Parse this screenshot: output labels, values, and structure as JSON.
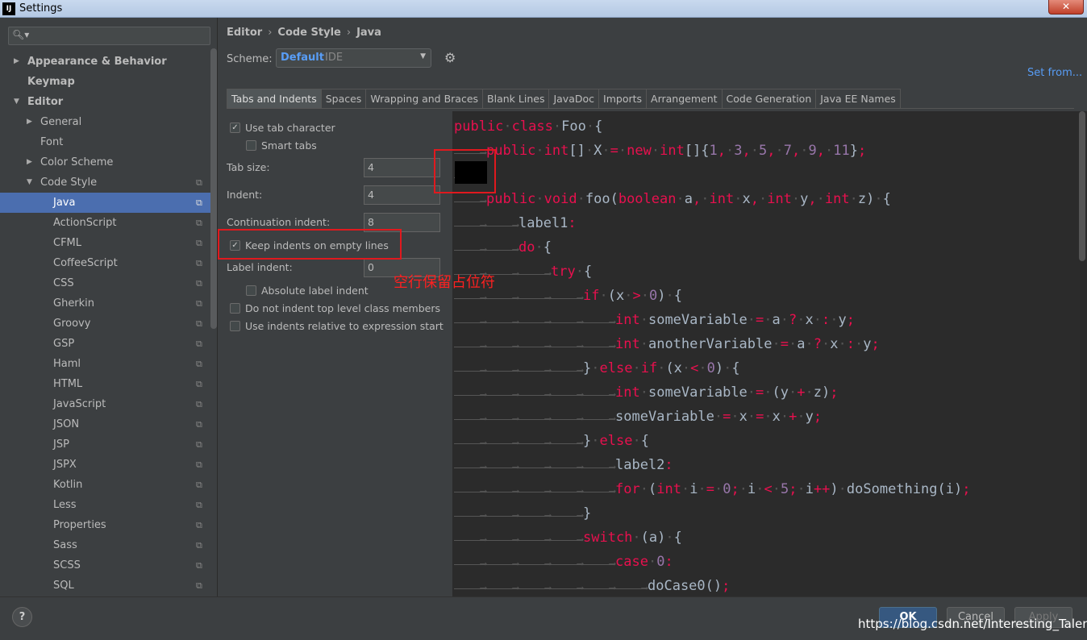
{
  "window": {
    "app_icon": "IJ",
    "title": "Settings",
    "close": "✕"
  },
  "sidebar": {
    "search_placeholder": "",
    "items": [
      {
        "label": "Appearance & Behavior",
        "bold": true,
        "arrow": "▶",
        "level": 0
      },
      {
        "label": "Keymap",
        "bold": true,
        "arrow": "",
        "level": 0
      },
      {
        "label": "Editor",
        "bold": true,
        "arrow": "▼",
        "level": 0
      },
      {
        "label": "General",
        "arrow": "▶",
        "level": 1
      },
      {
        "label": "Font",
        "arrow": "",
        "level": 1
      },
      {
        "label": "Color Scheme",
        "arrow": "▶",
        "level": 1
      },
      {
        "label": "Code Style",
        "arrow": "▼",
        "level": 1,
        "copy": true
      },
      {
        "label": "Java",
        "level": 2,
        "copy": true,
        "selected": true
      },
      {
        "label": "ActionScript",
        "level": 2,
        "copy": true
      },
      {
        "label": "CFML",
        "level": 2,
        "copy": true
      },
      {
        "label": "CoffeeScript",
        "level": 2,
        "copy": true
      },
      {
        "label": "CSS",
        "level": 2,
        "copy": true
      },
      {
        "label": "Gherkin",
        "level": 2,
        "copy": true
      },
      {
        "label": "Groovy",
        "level": 2,
        "copy": true
      },
      {
        "label": "GSP",
        "level": 2,
        "copy": true
      },
      {
        "label": "Haml",
        "level": 2,
        "copy": true
      },
      {
        "label": "HTML",
        "level": 2,
        "copy": true
      },
      {
        "label": "JavaScript",
        "level": 2,
        "copy": true
      },
      {
        "label": "JSON",
        "level": 2,
        "copy": true
      },
      {
        "label": "JSP",
        "level": 2,
        "copy": true
      },
      {
        "label": "JSPX",
        "level": 2,
        "copy": true
      },
      {
        "label": "Kotlin",
        "level": 2,
        "copy": true
      },
      {
        "label": "Less",
        "level": 2,
        "copy": true
      },
      {
        "label": "Properties",
        "level": 2,
        "copy": true
      },
      {
        "label": "Sass",
        "level": 2,
        "copy": true
      },
      {
        "label": "SCSS",
        "level": 2,
        "copy": true
      },
      {
        "label": "SQL",
        "level": 2,
        "copy": true
      }
    ]
  },
  "breadcrumb": {
    "p1": "Editor",
    "p2": "Code Style",
    "p3": "Java",
    "sep": "›"
  },
  "scheme": {
    "label": "Scheme:",
    "value": "Default",
    "suffix": "IDE",
    "set_from": "Set from..."
  },
  "tabs": [
    "Tabs and Indents",
    "Spaces",
    "Wrapping and Braces",
    "Blank Lines",
    "JavaDoc",
    "Imports",
    "Arrangement",
    "Code Generation",
    "Java EE Names"
  ],
  "options": {
    "use_tab_character": "Use tab character",
    "smart_tabs": "Smart tabs",
    "tab_size_label": "Tab size:",
    "tab_size": "4",
    "indent_label": "Indent:",
    "indent": "4",
    "continuation_label": "Continuation indent:",
    "continuation": "8",
    "keep_indents": "Keep indents on empty lines",
    "label_indent_label": "Label indent:",
    "label_indent": "0",
    "absolute_label": "Absolute label indent",
    "no_indent_top": "Do not indent top level class members",
    "relative_indents": "Use indents relative to expression start"
  },
  "annotation": "空行保留占位符",
  "code_lines": [
    {
      "indent": 0,
      "tokens": [
        [
          "kw",
          "public"
        ],
        [
          "dot",
          "·"
        ],
        [
          "kw",
          "class"
        ],
        [
          "dot",
          "·"
        ],
        [
          "t",
          "Foo"
        ],
        [
          "dot",
          "·"
        ],
        [
          "t",
          "{"
        ]
      ]
    },
    {
      "indent": 1,
      "tokens": [
        [
          "kw",
          "public"
        ],
        [
          "dot",
          "·"
        ],
        [
          "kw",
          "int"
        ],
        [
          "t",
          "[]"
        ],
        [
          "dot",
          "·"
        ],
        [
          "t",
          "X"
        ],
        [
          "dot",
          "·"
        ],
        [
          "kw",
          "="
        ],
        [
          "dot",
          "·"
        ],
        [
          "kw",
          "new"
        ],
        [
          "dot",
          "·"
        ],
        [
          "kw",
          "int"
        ],
        [
          "t",
          "[]{"
        ],
        [
          "n",
          "1"
        ],
        [
          "kw",
          ","
        ],
        [
          "dot",
          "·"
        ],
        [
          "n",
          "3"
        ],
        [
          "kw",
          ","
        ],
        [
          "dot",
          "·"
        ],
        [
          "n",
          "5"
        ],
        [
          "kw",
          ","
        ],
        [
          "dot",
          "·"
        ],
        [
          "n",
          "7"
        ],
        [
          "kw",
          ","
        ],
        [
          "dot",
          "·"
        ],
        [
          "n",
          "9"
        ],
        [
          "kw",
          ","
        ],
        [
          "dot",
          "·"
        ],
        [
          "n",
          "11"
        ],
        [
          "t",
          "}"
        ],
        [
          "kw",
          ";"
        ]
      ]
    },
    {
      "indent": 1,
      "tokens": []
    },
    {
      "indent": 1,
      "tokens": [
        [
          "kw",
          "public"
        ],
        [
          "dot",
          "·"
        ],
        [
          "kw",
          "void"
        ],
        [
          "dot",
          "·"
        ],
        [
          "t",
          "foo("
        ],
        [
          "kw",
          "boolean"
        ],
        [
          "dot",
          "·"
        ],
        [
          "t",
          "a"
        ],
        [
          "kw",
          ","
        ],
        [
          "dot",
          "·"
        ],
        [
          "kw",
          "int"
        ],
        [
          "dot",
          "·"
        ],
        [
          "t",
          "x"
        ],
        [
          "kw",
          ","
        ],
        [
          "dot",
          "·"
        ],
        [
          "kw",
          "int"
        ],
        [
          "dot",
          "·"
        ],
        [
          "t",
          "y"
        ],
        [
          "kw",
          ","
        ],
        [
          "dot",
          "·"
        ],
        [
          "kw",
          "int"
        ],
        [
          "dot",
          "·"
        ],
        [
          "t",
          "z)"
        ],
        [
          "dot",
          "·"
        ],
        [
          "t",
          "{"
        ]
      ]
    },
    {
      "indent": 2,
      "tokens": [
        [
          "t",
          "label1"
        ],
        [
          "kw",
          ":"
        ]
      ]
    },
    {
      "indent": 2,
      "tokens": [
        [
          "kw",
          "do"
        ],
        [
          "dot",
          "·"
        ],
        [
          "t",
          "{"
        ]
      ]
    },
    {
      "indent": 3,
      "tokens": [
        [
          "kw",
          "try"
        ],
        [
          "dot",
          "·"
        ],
        [
          "t",
          "{"
        ]
      ]
    },
    {
      "indent": 4,
      "tokens": [
        [
          "kw",
          "if"
        ],
        [
          "dot",
          "·"
        ],
        [
          "t",
          "(x"
        ],
        [
          "dot",
          "·"
        ],
        [
          "kw",
          ">"
        ],
        [
          "dot",
          "·"
        ],
        [
          "n",
          "0"
        ],
        [
          "t",
          ")"
        ],
        [
          "dot",
          "·"
        ],
        [
          "t",
          "{"
        ]
      ]
    },
    {
      "indent": 5,
      "tokens": [
        [
          "kw",
          "int"
        ],
        [
          "dot",
          "·"
        ],
        [
          "t",
          "someVariable"
        ],
        [
          "dot",
          "·"
        ],
        [
          "kw",
          "="
        ],
        [
          "dot",
          "·"
        ],
        [
          "t",
          "a"
        ],
        [
          "dot",
          "·"
        ],
        [
          "kw",
          "?"
        ],
        [
          "dot",
          "·"
        ],
        [
          "t",
          "x"
        ],
        [
          "dot",
          "·"
        ],
        [
          "kw",
          ":"
        ],
        [
          "dot",
          "·"
        ],
        [
          "t",
          "y"
        ],
        [
          "kw",
          ";"
        ]
      ]
    },
    {
      "indent": 5,
      "tokens": [
        [
          "kw",
          "int"
        ],
        [
          "dot",
          "·"
        ],
        [
          "t",
          "anotherVariable"
        ],
        [
          "dot",
          "·"
        ],
        [
          "kw",
          "="
        ],
        [
          "dot",
          "·"
        ],
        [
          "t",
          "a"
        ],
        [
          "dot",
          "·"
        ],
        [
          "kw",
          "?"
        ],
        [
          "dot",
          "·"
        ],
        [
          "t",
          "x"
        ],
        [
          "dot",
          "·"
        ],
        [
          "kw",
          ":"
        ],
        [
          "dot",
          "·"
        ],
        [
          "t",
          "y"
        ],
        [
          "kw",
          ";"
        ]
      ]
    },
    {
      "indent": 4,
      "tokens": [
        [
          "t",
          "}"
        ],
        [
          "dot",
          "·"
        ],
        [
          "kw",
          "else"
        ],
        [
          "dot",
          "·"
        ],
        [
          "kw",
          "if"
        ],
        [
          "dot",
          "·"
        ],
        [
          "t",
          "(x"
        ],
        [
          "dot",
          "·"
        ],
        [
          "kw",
          "<"
        ],
        [
          "dot",
          "·"
        ],
        [
          "n",
          "0"
        ],
        [
          "t",
          ")"
        ],
        [
          "dot",
          "·"
        ],
        [
          "t",
          "{"
        ]
      ]
    },
    {
      "indent": 5,
      "tokens": [
        [
          "kw",
          "int"
        ],
        [
          "dot",
          "·"
        ],
        [
          "t",
          "someVariable"
        ],
        [
          "dot",
          "·"
        ],
        [
          "kw",
          "="
        ],
        [
          "dot",
          "·"
        ],
        [
          "t",
          "(y"
        ],
        [
          "dot",
          "·"
        ],
        [
          "kw",
          "+"
        ],
        [
          "dot",
          "·"
        ],
        [
          "t",
          "z)"
        ],
        [
          "kw",
          ";"
        ]
      ]
    },
    {
      "indent": 5,
      "tokens": [
        [
          "t",
          "someVariable"
        ],
        [
          "dot",
          "·"
        ],
        [
          "kw",
          "="
        ],
        [
          "dot",
          "·"
        ],
        [
          "t",
          "x"
        ],
        [
          "dot",
          "·"
        ],
        [
          "kw",
          "="
        ],
        [
          "dot",
          "·"
        ],
        [
          "t",
          "x"
        ],
        [
          "dot",
          "·"
        ],
        [
          "kw",
          "+"
        ],
        [
          "dot",
          "·"
        ],
        [
          "t",
          "y"
        ],
        [
          "kw",
          ";"
        ]
      ]
    },
    {
      "indent": 4,
      "tokens": [
        [
          "t",
          "}"
        ],
        [
          "dot",
          "·"
        ],
        [
          "kw",
          "else"
        ],
        [
          "dot",
          "·"
        ],
        [
          "t",
          "{"
        ]
      ]
    },
    {
      "indent": 5,
      "tokens": [
        [
          "t",
          "label2"
        ],
        [
          "kw",
          ":"
        ]
      ]
    },
    {
      "indent": 5,
      "tokens": [
        [
          "kw",
          "for"
        ],
        [
          "dot",
          "·"
        ],
        [
          "t",
          "("
        ],
        [
          "kw",
          "int"
        ],
        [
          "dot",
          "·"
        ],
        [
          "t",
          "i"
        ],
        [
          "dot",
          "·"
        ],
        [
          "kw",
          "="
        ],
        [
          "dot",
          "·"
        ],
        [
          "n",
          "0"
        ],
        [
          "kw",
          ";"
        ],
        [
          "dot",
          "·"
        ],
        [
          "t",
          "i"
        ],
        [
          "dot",
          "·"
        ],
        [
          "kw",
          "<"
        ],
        [
          "dot",
          "·"
        ],
        [
          "n",
          "5"
        ],
        [
          "kw",
          ";"
        ],
        [
          "dot",
          "·"
        ],
        [
          "t",
          "i"
        ],
        [
          "kw",
          "++"
        ],
        [
          "t",
          ")"
        ],
        [
          "dot",
          "·"
        ],
        [
          "t",
          "doSomething(i)"
        ],
        [
          "kw",
          ";"
        ]
      ]
    },
    {
      "indent": 4,
      "tokens": [
        [
          "t",
          "}"
        ]
      ]
    },
    {
      "indent": 4,
      "tokens": [
        [
          "kw",
          "switch"
        ],
        [
          "dot",
          "·"
        ],
        [
          "t",
          "(a)"
        ],
        [
          "dot",
          "·"
        ],
        [
          "t",
          "{"
        ]
      ]
    },
    {
      "indent": 5,
      "tokens": [
        [
          "kw",
          "case"
        ],
        [
          "dot",
          "·"
        ],
        [
          "n",
          "0"
        ],
        [
          "kw",
          ":"
        ]
      ]
    },
    {
      "indent": 6,
      "tokens": [
        [
          "t",
          "doCase0()"
        ],
        [
          "kw",
          ";"
        ]
      ]
    }
  ],
  "footer": {
    "help": "?",
    "ok": "OK",
    "cancel": "Cancel",
    "apply": "Apply"
  },
  "watermark": "https://blog.csdn.net/Interesting_Talent"
}
